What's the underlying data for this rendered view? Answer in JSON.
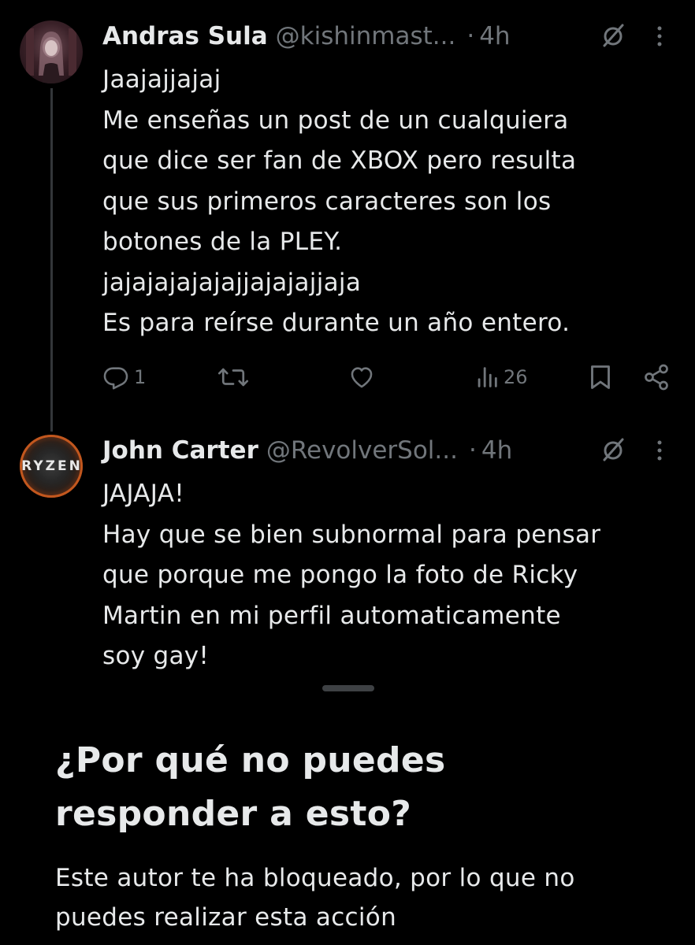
{
  "tweets": [
    {
      "author": {
        "name": "Andras Sula",
        "handle": "@kishinmast...",
        "time": "4h"
      },
      "lines": [
        "Jaajajjajaj",
        "Me enseñas un post de un cualquiera",
        "que dice ser fan de XBOX pero resulta",
        "que sus primeros caracteres son los",
        "botones de la PLEY.",
        "jajajajajajajjajajajjaja",
        "Es para reírse durante un año entero."
      ],
      "stats": {
        "replies": "1",
        "retweets": "",
        "likes": "",
        "views": "26"
      }
    },
    {
      "author": {
        "name": "John Carter",
        "handle": "@RevolverSol...",
        "time": "4h",
        "avatar_text": "RYZEN"
      },
      "lines": [
        "JAJAJA!",
        "Hay que se bien subnormal para pensar",
        "que porque me pongo la foto de Ricky",
        "Martin en mi perfil automaticamente",
        "soy gay!"
      ]
    }
  ],
  "sheet": {
    "title_lines": [
      "¿Por qué no puedes",
      "responder a esto?"
    ],
    "body_lines": [
      "Este autor te ha bloqueado, por lo que no",
      "puedes realizar esta acción"
    ]
  },
  "icons": {
    "reply": "reply-icon",
    "retweet": "retweet-icon",
    "like": "heart-icon",
    "views": "views-icon",
    "bookmark": "bookmark-icon",
    "share": "share-icon",
    "grok": "grok-icon",
    "more": "more-icon"
  },
  "colors": {
    "background": "#000000",
    "text": "#e7e9ea",
    "secondary": "#71767b",
    "thread_line": "#333639",
    "sheet_handle": "#3e4144"
  }
}
